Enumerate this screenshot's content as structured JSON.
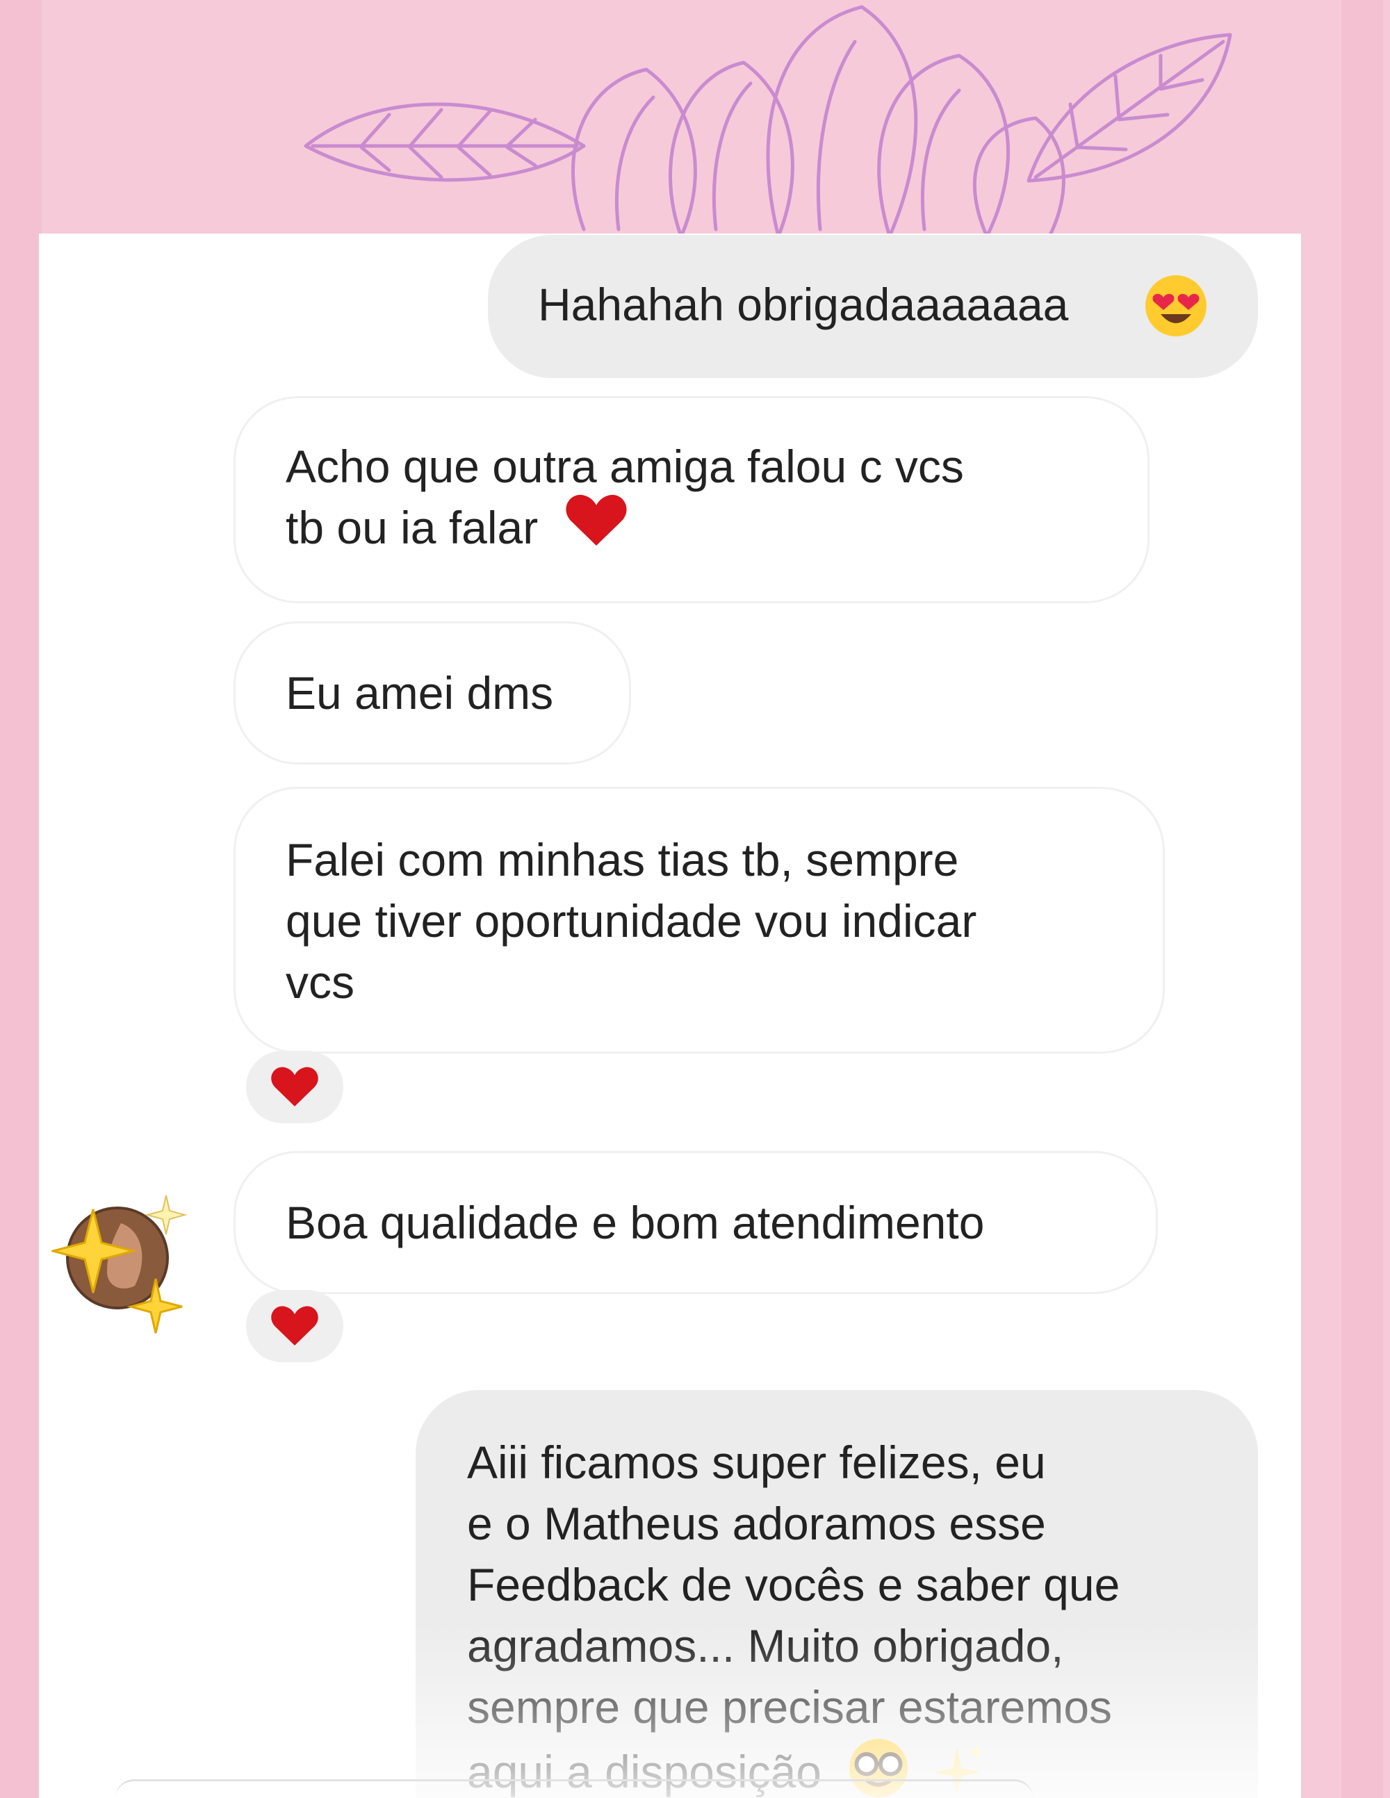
{
  "messages": [
    {
      "id": "m1",
      "direction": "sent",
      "lines": [
        "Hahahah obrigadaaaaaaa"
      ],
      "emoji": "smiling-face-heart-eyes"
    },
    {
      "id": "m2",
      "direction": "received",
      "lines": [
        "Acho que outra amiga falou c vcs",
        "tb ou ia falar"
      ],
      "emoji": "red-heart"
    },
    {
      "id": "m3",
      "direction": "received",
      "lines": [
        "Eu amei dms"
      ]
    },
    {
      "id": "m4",
      "direction": "received",
      "lines": [
        "Falei com minhas tias tb, sempre",
        "que tiver oportunidade vou indicar",
        "vcs"
      ],
      "reaction": "red-heart"
    },
    {
      "id": "m5",
      "direction": "received",
      "lines": [
        "Boa qualidade e bom atendimento"
      ],
      "reaction": "red-heart",
      "avatar": "sparkles-avatar"
    },
    {
      "id": "m6",
      "direction": "sent",
      "lines": [
        "Aiii ficamos super felizes, eu",
        "e o Matheus adoramos esse",
        "Feedback de vocês e saber que",
        "agradamos... Muito obrigado,",
        "sempre que precisar estaremos",
        "aqui a disposição"
      ],
      "emoji": "nerd-face-sparkles"
    }
  ],
  "colors": {
    "background": "#f6cad9",
    "flower_line": "#c98bd0",
    "sent_bubble": "#ececec",
    "received_bubble": "#ffffff",
    "heart": "#d8141c"
  }
}
